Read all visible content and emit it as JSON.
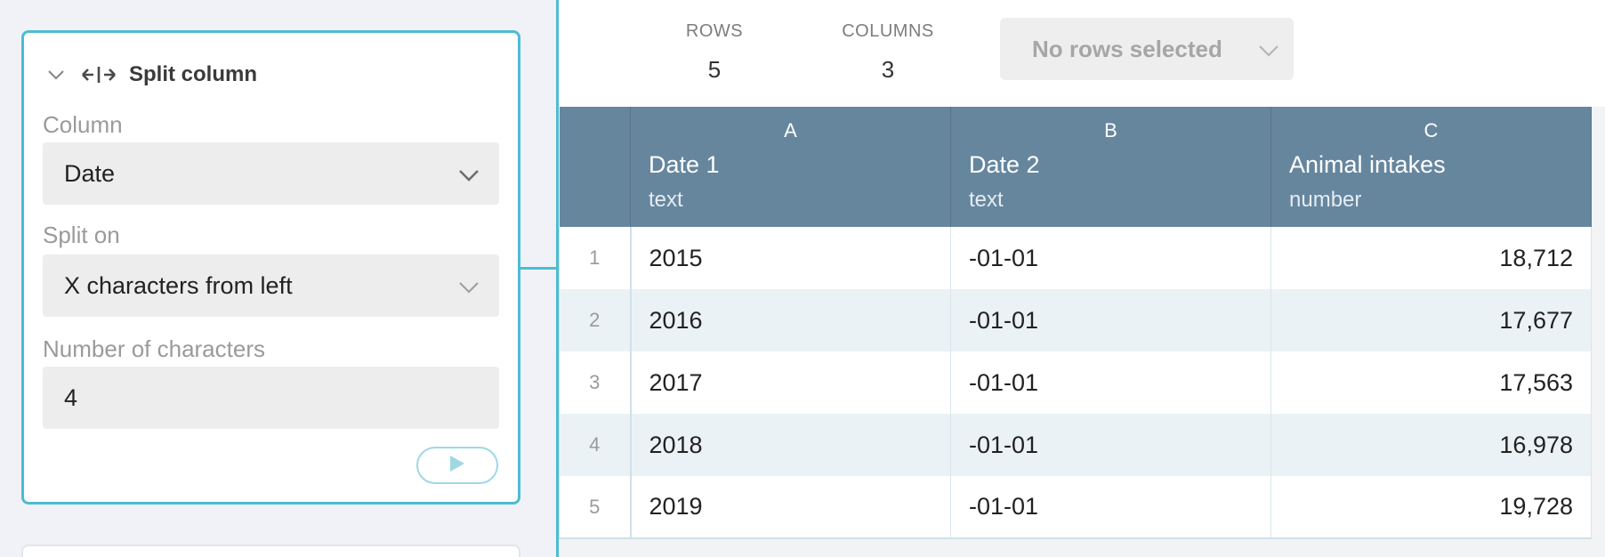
{
  "module": {
    "title": "Split column",
    "column_label": "Column",
    "column_value": "Date",
    "split_on_label": "Split on",
    "split_on_value": "X characters from left",
    "num_chars_label": "Number of characters",
    "num_chars_value": "4"
  },
  "stats": {
    "rows_label": "ROWS",
    "rows_value": "5",
    "columns_label": "COLUMNS",
    "columns_value": "3",
    "selection_label": "No rows selected"
  },
  "table": {
    "columns": [
      {
        "letter": "A",
        "name": "Date 1",
        "type": "text"
      },
      {
        "letter": "B",
        "name": "Date 2",
        "type": "text"
      },
      {
        "letter": "C",
        "name": "Animal intakes",
        "type": "number"
      }
    ],
    "rows": [
      {
        "num": "1",
        "a": "2015",
        "b": "-01-01",
        "c": "18,712"
      },
      {
        "num": "2",
        "a": "2016",
        "b": "-01-01",
        "c": "17,677"
      },
      {
        "num": "3",
        "a": "2017",
        "b": "-01-01",
        "c": "17,563"
      },
      {
        "num": "4",
        "a": "2018",
        "b": "-01-01",
        "c": "16,978"
      },
      {
        "num": "5",
        "a": "2019",
        "b": "-01-01",
        "c": "19,728"
      }
    ]
  },
  "colors": {
    "accent": "#4cbcd3",
    "header_bg": "#66869e",
    "stripe": "#ebf2f5"
  },
  "icons": [
    "chevron-down-icon",
    "split-column-icon",
    "dropdown-caret-icon",
    "play-icon"
  ]
}
